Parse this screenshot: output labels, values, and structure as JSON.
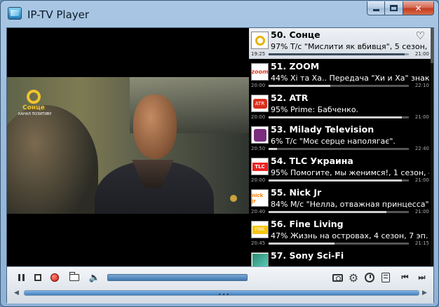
{
  "window": {
    "title": "IP-TV Player",
    "controls": {
      "minimize": "minimize",
      "maximize": "maximize",
      "close": "✕"
    }
  },
  "video": {
    "channel_logo_text": "Сонце",
    "channel_logo_tagline": "КАНАЛ ПОЗИТИВУ"
  },
  "channels": [
    {
      "name": "50. Сонце",
      "program": "97% Т/с \"Мислити як вбивця\", 5 сезон, 15 і...",
      "start": "19:25",
      "end": "21:00",
      "progress": 0.97,
      "logo": "sonce-logo",
      "selected": true,
      "favorite_icon": "heart-icon"
    },
    {
      "name": "51. ZOOM",
      "program": "44% Хі та Ха.. Передача \"Хи и Ха\" знакомит...",
      "start": "20:00",
      "end": "22:10",
      "progress": 0.44,
      "logo": "zoom-logo",
      "logo_text": "zoom"
    },
    {
      "name": "52. ATR",
      "program": "95% Prime: Бабченко.",
      "start": "20:00",
      "end": "21:00",
      "progress": 0.95,
      "logo": "atr-logo",
      "logo_text": "ATR"
    },
    {
      "name": "53. Milady Television",
      "program": "6% Т/с \"Моє серце наполягає\".",
      "start": "20:50",
      "end": "22:40",
      "progress": 0.06,
      "logo": "milady-logo"
    },
    {
      "name": "54. TLC Украина",
      "program": "95% Помогите, мы женимся!, 1 сезон, 4 эп...",
      "start": "20:00",
      "end": "21:00",
      "progress": 0.95,
      "logo": "tlc-logo",
      "logo_text": "TLC"
    },
    {
      "name": "55. Nick Jr",
      "program": "84% М/с \"Нелла, отважная принцесса\", 1 с...",
      "start": "20:40",
      "end": "21:00",
      "progress": 0.84,
      "logo": "nickjr-logo",
      "logo_text": "nick jr"
    },
    {
      "name": "56. Fine Living",
      "program": "47% Жизнь на островах, 4 сезон, 7 эп. Из ...",
      "start": "20:45",
      "end": "21:15",
      "progress": 0.47,
      "logo": "fineliving-logo",
      "logo_text": "FINE"
    },
    {
      "name": "57. Sony Sci-Fi",
      "program": "",
      "start": "",
      "end": "",
      "progress": 0.5,
      "logo": "sonyscifi-logo"
    }
  ],
  "controls": {
    "pause": "pause-icon",
    "stop": "stop-icon",
    "record": "record-icon",
    "open": "folder-icon",
    "volume": "speaker-icon",
    "volume_level": 1.0,
    "screenshot": "camera-icon",
    "settings": "gear-icon",
    "schedule": "clock-icon",
    "playlist": "list-icon",
    "prev": "⏮",
    "next": "⏭",
    "gear_glyph": "⚙",
    "speaker_glyph": "🔈",
    "seek_left": "◀",
    "seek_right": "▶",
    "seek_grip": "•••"
  },
  "colors": {
    "selected_row_bg": "#e3e8ee",
    "record_red": "#d21a0c",
    "accent_blue": "#3e77b0"
  }
}
